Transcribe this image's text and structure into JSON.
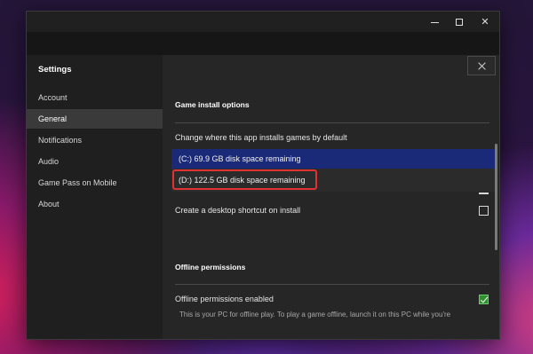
{
  "sidebar": {
    "title": "Settings",
    "items": [
      {
        "label": "Account"
      },
      {
        "label": "General"
      },
      {
        "label": "Notifications"
      },
      {
        "label": "Audio"
      },
      {
        "label": "Game Pass on Mobile"
      },
      {
        "label": "About"
      }
    ],
    "active": "General"
  },
  "game_install": {
    "title": "Game install options",
    "change_location_label": "Change where this app installs games by default",
    "drive_options": [
      {
        "label": "(C:) 69.9 GB disk space remaining",
        "selected": true
      },
      {
        "label": "(D:) 122.5 GB disk space remaining",
        "highlighted": true
      }
    ],
    "desktop_shortcut_label": "Create a desktop shortcut on install",
    "desktop_shortcut_checked": false
  },
  "offline": {
    "title": "Offline permissions",
    "enabled_label": "Offline permissions enabled",
    "enabled_checked": true,
    "helper_text": "This is your PC for offline play. To play a game offline, launch it on this PC while you're"
  },
  "colors": {
    "selected_option": "#1a2a78",
    "highlight_border": "#e03232",
    "checkbox_checked": "#2f8f2f"
  }
}
